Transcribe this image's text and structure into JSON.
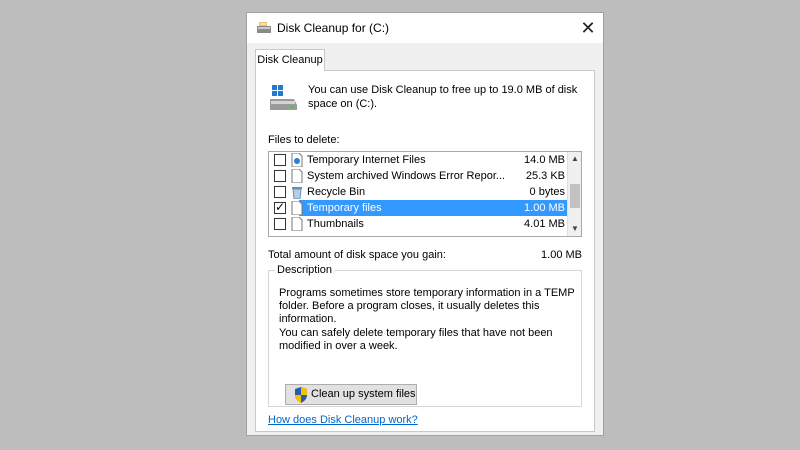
{
  "window": {
    "title": "Disk Cleanup for  (C:)",
    "close_glyph": "✕",
    "title_icon": "disk-cleanup-icon"
  },
  "tabs": [
    {
      "label": "Disk Cleanup"
    }
  ],
  "intro": {
    "text": "You can use Disk Cleanup to free up to 19.0 MB of disk space on  (C:).",
    "icon": "drive-icon"
  },
  "files": {
    "label": "Files to delete:",
    "items": [
      {
        "name": "Temporary Internet Files",
        "size": "14.0 MB",
        "checked": false,
        "selected": false,
        "icon": "internet-files-icon"
      },
      {
        "name": "System archived Windows Error Repor...",
        "size": "25.3 KB",
        "checked": false,
        "selected": false,
        "icon": "document-icon"
      },
      {
        "name": "Recycle Bin",
        "size": "0 bytes",
        "checked": false,
        "selected": false,
        "icon": "recycle-bin-icon"
      },
      {
        "name": "Temporary files",
        "size": "1.00 MB",
        "checked": true,
        "selected": true,
        "icon": "document-icon"
      },
      {
        "name": "Thumbnails",
        "size": "4.01 MB",
        "checked": false,
        "selected": false,
        "icon": "document-icon"
      }
    ],
    "scroll": {
      "up": "▲",
      "down": "▼"
    }
  },
  "total": {
    "label": "Total amount of disk space you gain:",
    "value": "1.00 MB"
  },
  "description": {
    "legend": "Description",
    "p1": "Programs sometimes store temporary information in a TEMP folder. Before a program closes, it usually deletes this information.",
    "p2": "You can safely delete temporary files that have not been modified in over a week."
  },
  "buttons": {
    "cleanup_system": "Clean up system files"
  },
  "help_link": "How does Disk Cleanup work?",
  "colors": {
    "selection": "#3399ff",
    "link": "#0066cc",
    "background": "#bdbdbd"
  }
}
